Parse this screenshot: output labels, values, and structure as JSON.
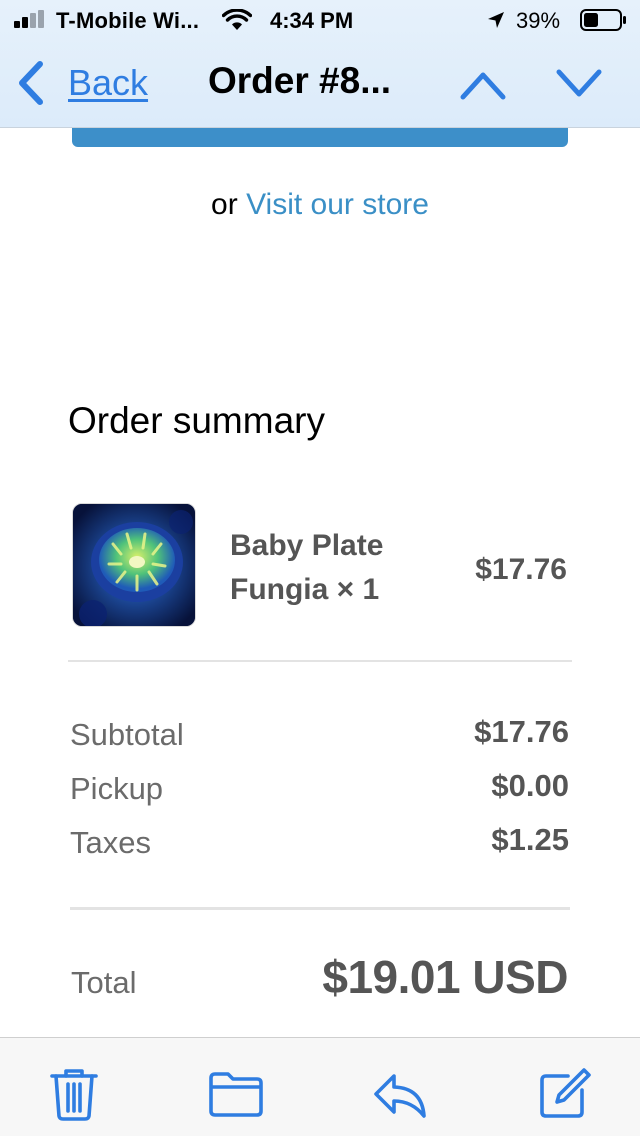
{
  "status_bar": {
    "carrier": "T-Mobile Wi...",
    "time": "4:34 PM",
    "battery": "39%",
    "icons": [
      "signal-icon",
      "wifi-icon",
      "location-arrow-icon",
      "battery-icon"
    ]
  },
  "nav": {
    "back_label": "Back",
    "title": "Order #8...",
    "icons": [
      "chevron-left-icon",
      "chevron-up-icon",
      "chevron-down-icon"
    ]
  },
  "content": {
    "or_label": "or",
    "visit_link": "Visit our store",
    "summary_title": "Order summary",
    "product": {
      "name": "Baby Plate Fungia × 1",
      "price": "$17.76"
    },
    "lines": [
      {
        "label": "Subtotal",
        "value": "$17.76"
      },
      {
        "label": "Pickup",
        "value": "$0.00"
      },
      {
        "label": "Taxes",
        "value": "$1.25"
      }
    ],
    "total_label": "Total",
    "total_value": "$19.01 USD"
  },
  "toolbar": {
    "icons": [
      "trash-icon",
      "folder-icon",
      "reply-icon",
      "compose-icon"
    ]
  },
  "colors": {
    "accent": "#2f7de1",
    "link": "#3a8fc6",
    "button_blue": "#3d8fc9",
    "muted_text": "#6b6b6b",
    "value_text": "#555555"
  }
}
